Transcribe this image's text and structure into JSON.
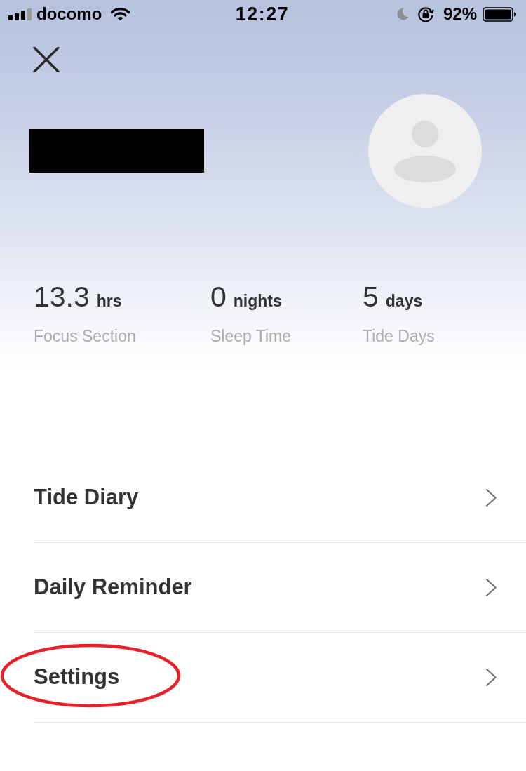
{
  "status_bar": {
    "carrier": "docomo",
    "time": "12:27",
    "battery": "92%"
  },
  "stats": [
    {
      "value": "13.3",
      "unit": "hrs",
      "label": "Focus Section"
    },
    {
      "value": "0",
      "unit": "nights",
      "label": "Sleep Time"
    },
    {
      "value": "5",
      "unit": "days",
      "label": "Tide Days"
    }
  ],
  "menu": [
    {
      "label": "Tide Diary",
      "highlighted": false
    },
    {
      "label": "Daily Reminder",
      "highlighted": false
    },
    {
      "label": "Settings",
      "highlighted": true
    }
  ]
}
